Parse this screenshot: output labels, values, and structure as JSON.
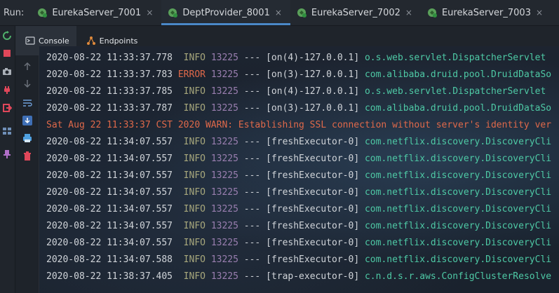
{
  "run_label": "Run:",
  "tabs": [
    {
      "label": "EurekaServer_7001",
      "active": false
    },
    {
      "label": "DeptProvider_8001",
      "active": true
    },
    {
      "label": "EurekaServer_7002",
      "active": false
    },
    {
      "label": "EurekaServer_7003",
      "active": false
    }
  ],
  "close_glyph": "×",
  "console_tabs": [
    {
      "label": "Console",
      "icon": "console-icon",
      "active": true
    },
    {
      "label": "Endpoints",
      "icon": "endpoints-icon",
      "active": false
    }
  ],
  "colors": {
    "info": "#a7a77c",
    "error": "#e0694a",
    "logger": "#4ec9a5",
    "accent": "#4a88c7"
  },
  "log_lines": [
    {
      "type": "log",
      "ts": "2020-08-22 11:33:37.778",
      "level": "INFO",
      "pid": "13225",
      "sep": "---",
      "thread": "[on(4)-127.0.0.1]",
      "logger": "o.s.web.servlet.DispatcherServlet"
    },
    {
      "type": "log",
      "ts": "2020-08-22 11:33:37.783",
      "level": "ERROR",
      "pid": "13225",
      "sep": "---",
      "thread": "[on(3)-127.0.0.1]",
      "logger": "com.alibaba.druid.pool.DruidDataSo"
    },
    {
      "type": "log",
      "ts": "2020-08-22 11:33:37.785",
      "level": "INFO",
      "pid": "13225",
      "sep": "---",
      "thread": "[on(4)-127.0.0.1]",
      "logger": "o.s.web.servlet.DispatcherServlet"
    },
    {
      "type": "log",
      "ts": "2020-08-22 11:33:37.787",
      "level": "INFO",
      "pid": "13225",
      "sep": "---",
      "thread": "[on(3)-127.0.0.1]",
      "logger": "com.alibaba.druid.pool.DruidDataSo"
    },
    {
      "type": "warn",
      "text": "Sat Aug 22 11:33:37 CST 2020 WARN: Establishing SSL connection without server's identity ver"
    },
    {
      "type": "log",
      "ts": "2020-08-22 11:34:07.557",
      "level": "INFO",
      "pid": "13225",
      "sep": "---",
      "thread": "[freshExecutor-0]",
      "logger": "com.netflix.discovery.DiscoveryCli"
    },
    {
      "type": "log",
      "ts": "2020-08-22 11:34:07.557",
      "level": "INFO",
      "pid": "13225",
      "sep": "---",
      "thread": "[freshExecutor-0]",
      "logger": "com.netflix.discovery.DiscoveryCli"
    },
    {
      "type": "log",
      "ts": "2020-08-22 11:34:07.557",
      "level": "INFO",
      "pid": "13225",
      "sep": "---",
      "thread": "[freshExecutor-0]",
      "logger": "com.netflix.discovery.DiscoveryCli"
    },
    {
      "type": "log",
      "ts": "2020-08-22 11:34:07.557",
      "level": "INFO",
      "pid": "13225",
      "sep": "---",
      "thread": "[freshExecutor-0]",
      "logger": "com.netflix.discovery.DiscoveryCli"
    },
    {
      "type": "log",
      "ts": "2020-08-22 11:34:07.557",
      "level": "INFO",
      "pid": "13225",
      "sep": "---",
      "thread": "[freshExecutor-0]",
      "logger": "com.netflix.discovery.DiscoveryCli"
    },
    {
      "type": "log",
      "ts": "2020-08-22 11:34:07.557",
      "level": "INFO",
      "pid": "13225",
      "sep": "---",
      "thread": "[freshExecutor-0]",
      "logger": "com.netflix.discovery.DiscoveryCli"
    },
    {
      "type": "log",
      "ts": "2020-08-22 11:34:07.557",
      "level": "INFO",
      "pid": "13225",
      "sep": "---",
      "thread": "[freshExecutor-0]",
      "logger": "com.netflix.discovery.DiscoveryCli"
    },
    {
      "type": "log",
      "ts": "2020-08-22 11:34:07.588",
      "level": "INFO",
      "pid": "13225",
      "sep": "---",
      "thread": "[freshExecutor-0]",
      "logger": "com.netflix.discovery.DiscoveryCli"
    },
    {
      "type": "log",
      "ts": "2020-08-22 11:38:37.405",
      "level": "INFO",
      "pid": "13225",
      "sep": "---",
      "thread": "[trap-executor-0]",
      "logger": "c.n.d.s.r.aws.ConfigClusterResolve"
    }
  ]
}
